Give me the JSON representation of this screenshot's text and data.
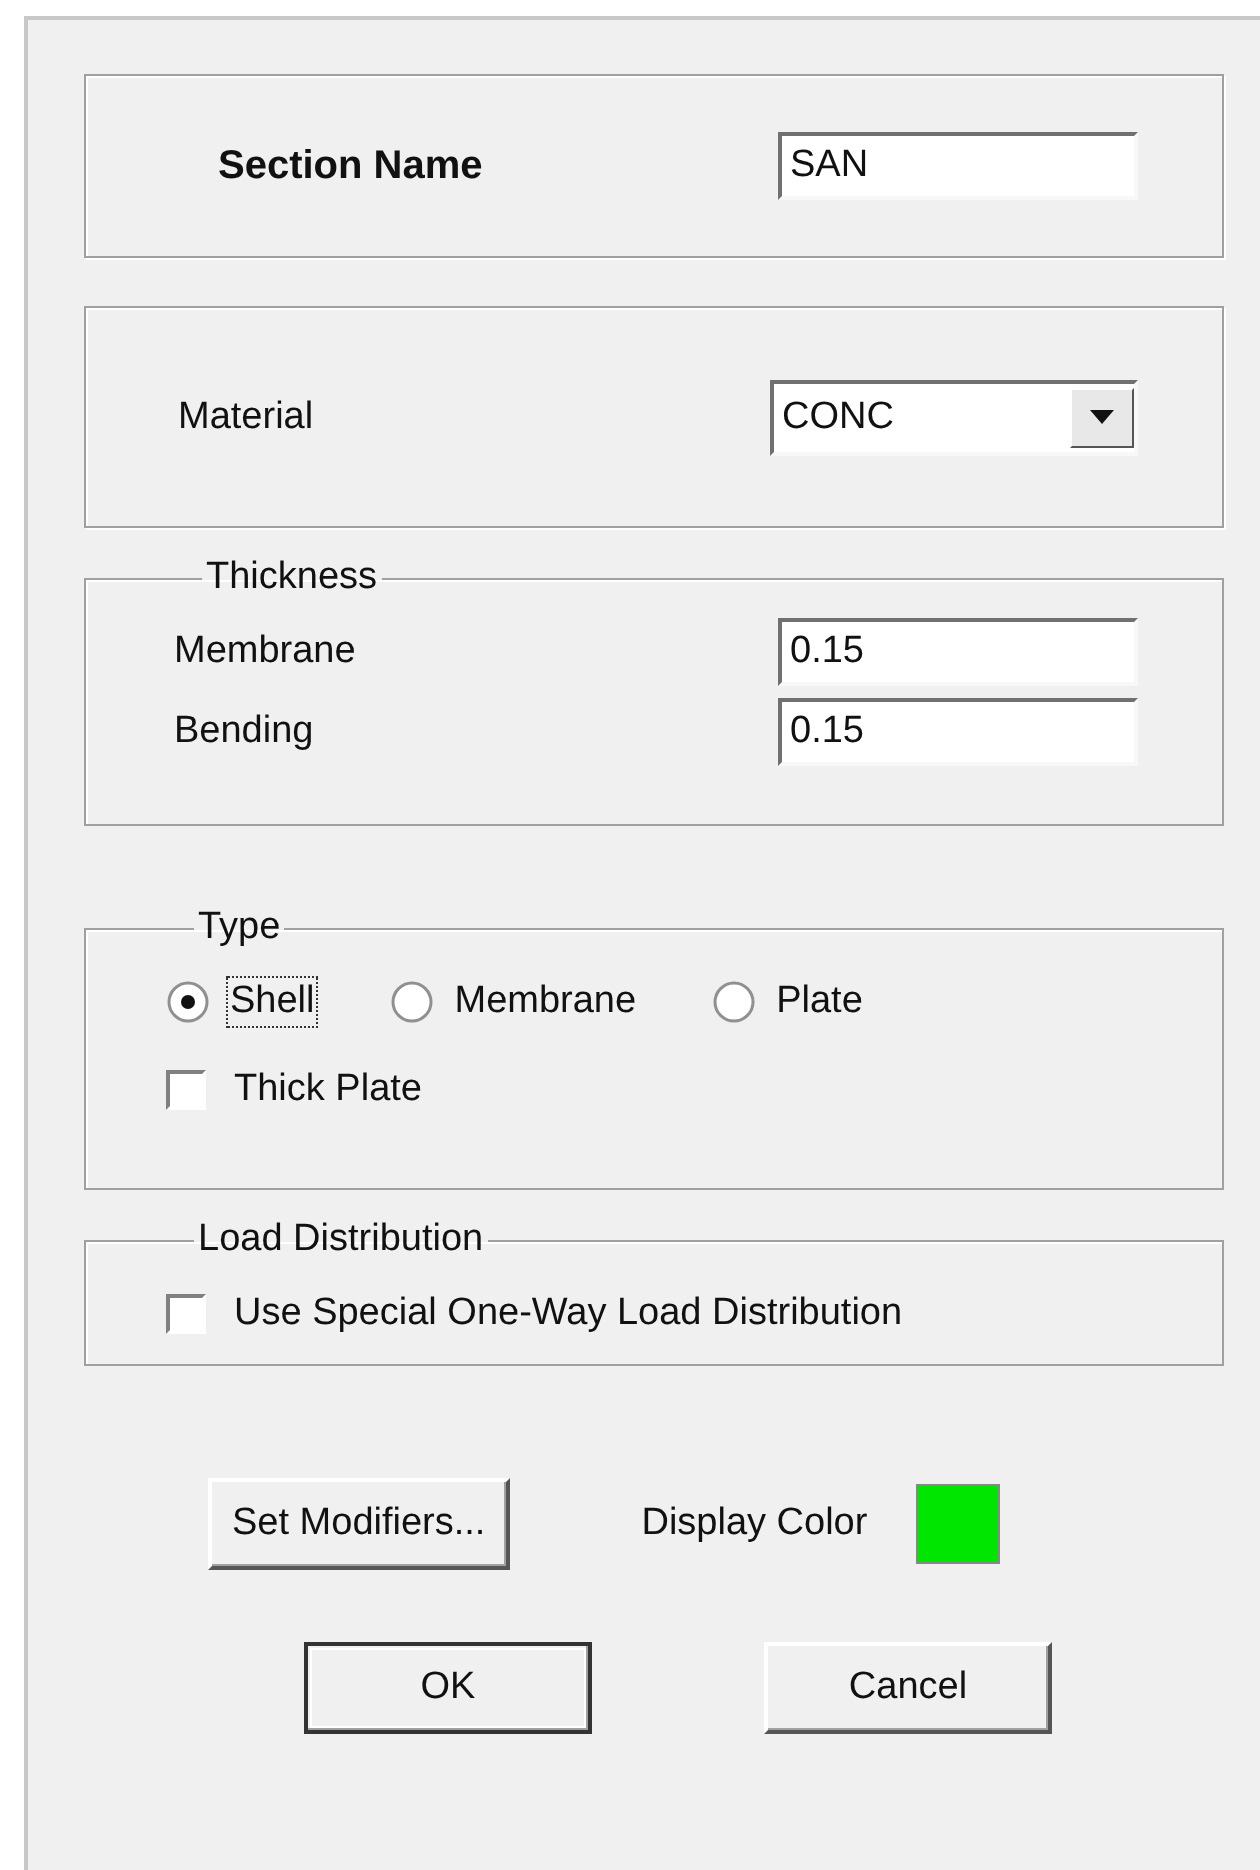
{
  "section_name": {
    "label": "Section Name",
    "value": "SAN"
  },
  "material": {
    "label": "Material",
    "value": "CONC"
  },
  "thickness": {
    "title": "Thickness",
    "fields": [
      {
        "label": "Membrane",
        "value": "0.15"
      },
      {
        "label": "Bending",
        "value": "0.15"
      }
    ]
  },
  "type": {
    "title": "Type",
    "options": [
      {
        "label": "Shell",
        "selected": true
      },
      {
        "label": "Membrane",
        "selected": false
      },
      {
        "label": "Plate",
        "selected": false
      }
    ],
    "thick_plate": {
      "label": "Thick Plate",
      "checked": false
    }
  },
  "load_distribution": {
    "title": "Load Distribution",
    "checkbox": {
      "label": "Use Special One-Way Load Distribution",
      "checked": false
    }
  },
  "set_modifiers": "Set Modifiers...",
  "display_color": {
    "label": "Display Color",
    "color": "#00e600"
  },
  "buttons": [
    {
      "label": "OK",
      "default": true
    },
    {
      "label": "Cancel",
      "default": false
    }
  ]
}
